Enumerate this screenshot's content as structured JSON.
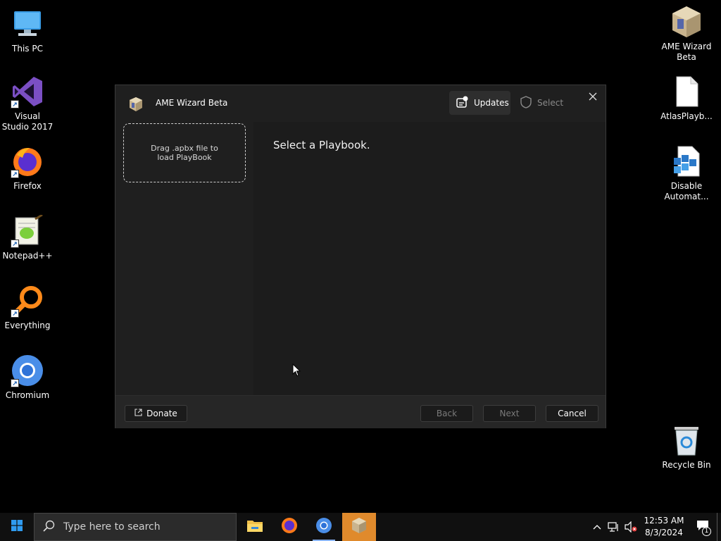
{
  "desktop": {
    "icons_left": [
      {
        "label": "This PC"
      },
      {
        "label": "Visual Studio 2017"
      },
      {
        "label": "Firefox"
      },
      {
        "label": "Notepad++"
      },
      {
        "label": "Everything"
      },
      {
        "label": "Chromium"
      }
    ],
    "icons_right": [
      {
        "label": "AME Wizard Beta"
      },
      {
        "label": "AtlasPlayb..."
      },
      {
        "label": "Disable Automat..."
      },
      {
        "label": "Recycle Bin"
      }
    ]
  },
  "window": {
    "title": "AME Wizard Beta",
    "updates_label": "Updates",
    "select_label": "Select",
    "dropzone_text": "Drag .apbx file to load PlayBook",
    "main_heading": "Select a Playbook.",
    "footer": {
      "donate_label": "Donate",
      "back_label": "Back",
      "next_label": "Next",
      "cancel_label": "Cancel"
    }
  },
  "taskbar": {
    "search_placeholder": "Type here to search",
    "clock_time": "12:53 AM",
    "clock_date": "8/3/2024",
    "notification_count": "1"
  },
  "colors": {
    "window_bg": "#1f1f1f",
    "active_app": "#e08a2c",
    "taskbar": "#101010"
  }
}
